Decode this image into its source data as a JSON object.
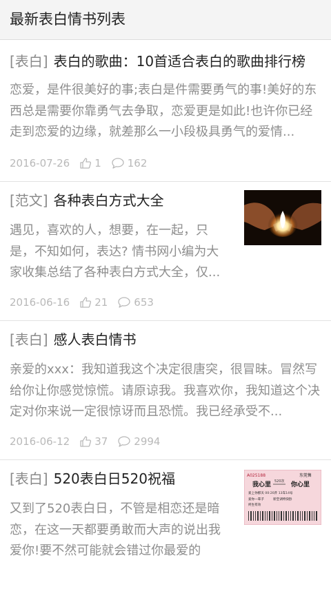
{
  "header": {
    "title": "最新表白情书列表"
  },
  "articles": [
    {
      "tag": "[表白]",
      "title": "表白的歌曲：10首适合表白的歌曲排行榜",
      "summary": "恋爱，是件很美好的事;表白是件需要勇气的事!美好的东西总是需要你靠勇气去争取，恋爱更是如此!也许你已经走到恋爱的边缘，就差那么一小段极具勇气的爱情...",
      "date": "2016-07-26",
      "likes": "1",
      "comments": "162"
    },
    {
      "tag": "[范文]",
      "title": "各种表白方式大全",
      "summary": "遇见，喜欢的人，想要，在一起，只是，不知如何，表达? 情书网小编为大家收集总结了各种表白方式大全，仅...",
      "date": "2016-06-16",
      "likes": "21",
      "comments": "653"
    },
    {
      "tag": "[表白]",
      "title": "感人表白情书",
      "summary": "亲爱的xxx：我知道我这个决定很唐突，很冒昧。冒然写给你让你感觉惊慌。请原谅我。我喜欢你，我知道这个决定对你来说一定很惊讶而且恐慌。我已经承受不...",
      "date": "2016-06-12",
      "likes": "37",
      "comments": "2994"
    },
    {
      "tag": "[表白]",
      "title": "520表白日520祝福",
      "summary": "又到了520表白日，不管是相恋还是暗恋，在这一天都要勇敢而大声的说出我爱你!要不然可能就会错过你最爱的",
      "ticket": {
        "serial": "A025188",
        "station_office": "东莞售",
        "from": "我心里",
        "to": "你心里",
        "train": "520次",
        "date_line": "爱上你那天  00:20开  13车14号",
        "seat_class": "爱你一辈子",
        "note": "新空调特快卧",
        "price": "终生有效"
      }
    }
  ]
}
